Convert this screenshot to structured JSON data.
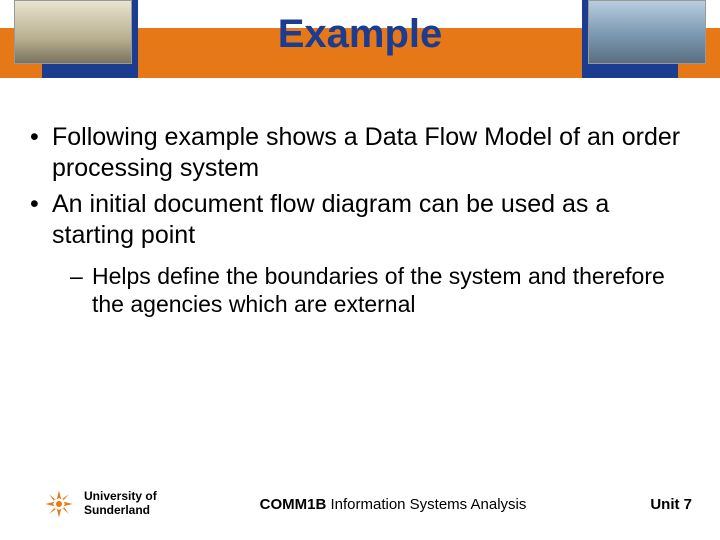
{
  "header": {
    "title": "Example"
  },
  "content": {
    "bullets": [
      "Following example shows a Data Flow Model of an order processing system",
      "An initial document flow diagram can be used as a starting point"
    ],
    "subbullets": [
      "Helps define the boundaries of the system and therefore the agencies which are external"
    ]
  },
  "footer": {
    "university_line1": "University of",
    "university_line2": "Sunderland",
    "course_code": "COMM1B",
    "course_name": " Information Systems Analysis",
    "unit": "Unit 7"
  }
}
